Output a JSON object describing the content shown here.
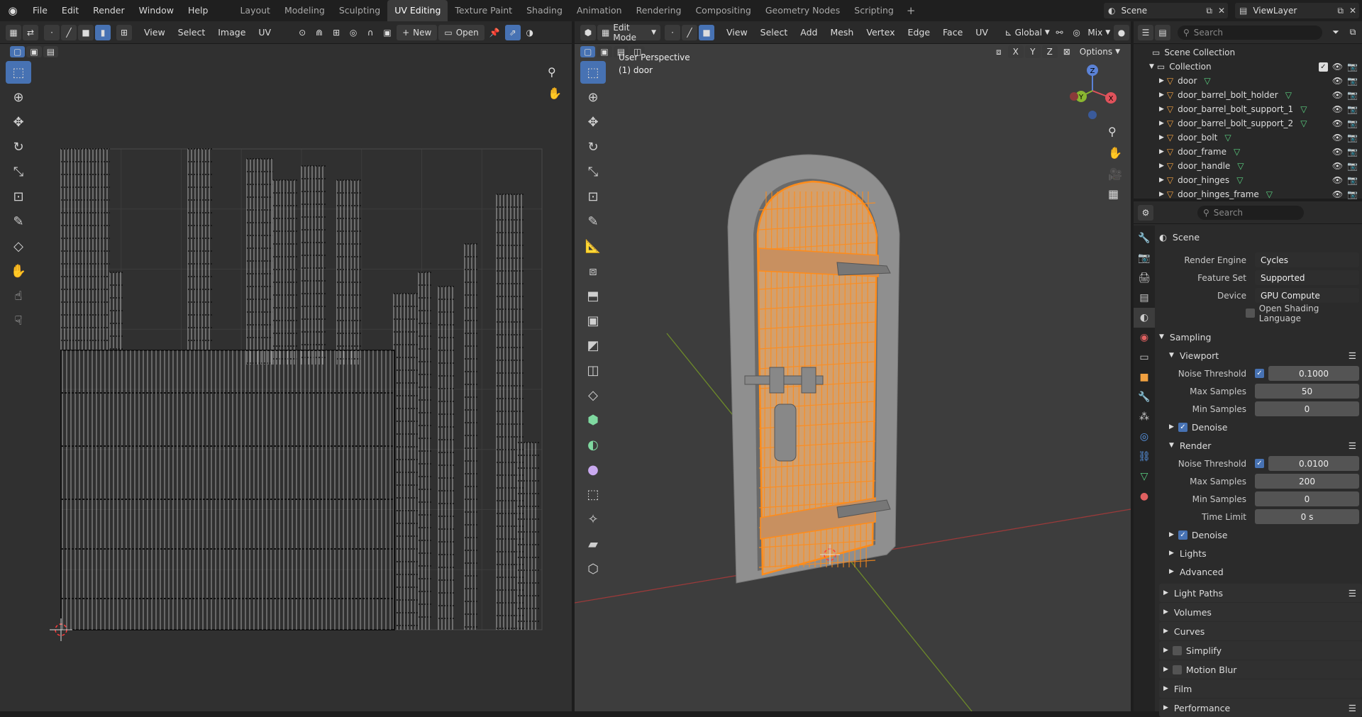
{
  "top_menu": [
    "File",
    "Edit",
    "Render",
    "Window",
    "Help"
  ],
  "workspaces": [
    "Layout",
    "Modeling",
    "Sculpting",
    "UV Editing",
    "Texture Paint",
    "Shading",
    "Animation",
    "Rendering",
    "Compositing",
    "Geometry Nodes",
    "Scripting"
  ],
  "active_workspace": "UV Editing",
  "scene_field": "Scene",
  "viewlayer_field": "ViewLayer",
  "uv_header": {
    "menus": [
      "View",
      "Select",
      "Image",
      "UV"
    ],
    "new_label": "New",
    "open_label": "Open"
  },
  "viewport_header": {
    "mode": "Edit Mode",
    "menus": [
      "View",
      "Select",
      "Add",
      "Mesh",
      "Vertex",
      "Edge",
      "Face",
      "UV"
    ],
    "orientation": "Global",
    "shading_mix": "Mix",
    "options": "Options",
    "axis_x": "X",
    "axis_y": "Y",
    "axis_z": "Z"
  },
  "viewport_info": {
    "line1": "User Perspective",
    "line2": "(1) door"
  },
  "gizmo": {
    "x": "X",
    "y": "Y",
    "z": "Z"
  },
  "outliner": {
    "search_placeholder": "Search",
    "root": "Scene Collection",
    "collection": "Collection",
    "objects": [
      "door",
      "door_barrel_bolt_holder",
      "door_barrel_bolt_support_1",
      "door_barrel_bolt_support_2",
      "door_bolt",
      "door_frame",
      "door_handle",
      "door_hinges",
      "door_hinges_frame"
    ]
  },
  "properties": {
    "search_placeholder": "Search",
    "context": "Scene",
    "render_engine_label": "Render Engine",
    "render_engine": "Cycles",
    "feature_set_label": "Feature Set",
    "feature_set": "Supported",
    "device_label": "Device",
    "device": "GPU Compute",
    "osl_label": "Open Shading Language",
    "sampling": "Sampling",
    "viewport": "Viewport",
    "noise_threshold_label": "Noise Threshold",
    "vp_noise": "0.1000",
    "max_samples_label": "Max Samples",
    "vp_max": "50",
    "min_samples_label": "Min Samples",
    "vp_min": "0",
    "denoise_label": "Denoise",
    "render": "Render",
    "r_noise": "0.0100",
    "r_max": "200",
    "r_min": "0",
    "time_limit_label": "Time Limit",
    "time_limit": "0 s",
    "lights": "Lights",
    "advanced": "Advanced",
    "light_paths": "Light Paths",
    "volumes": "Volumes",
    "curves": "Curves",
    "simplify": "Simplify",
    "motion_blur": "Motion Blur",
    "film": "Film",
    "performance": "Performance"
  },
  "colors": {
    "accent": "#4772b3",
    "selection_orange": "#ff8c1a",
    "bg": "#303030"
  }
}
